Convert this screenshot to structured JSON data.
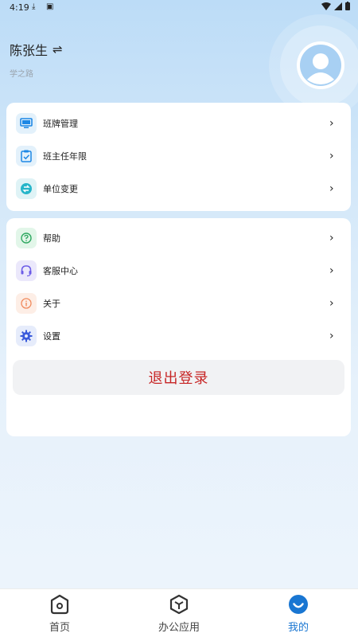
{
  "status_bar": {
    "time": "4:19"
  },
  "profile": {
    "name": "陈张生",
    "switch_icon": "⇌",
    "subtitle": "学之路"
  },
  "group1": [
    {
      "label": "班牌管理",
      "icon": "monitor-icon"
    },
    {
      "label": "班主任年限",
      "icon": "clipboard-check-icon"
    },
    {
      "label": "单位变更",
      "icon": "exchange-icon"
    }
  ],
  "group2": [
    {
      "label": "帮助",
      "icon": "help-circle-icon"
    },
    {
      "label": "客服中心",
      "icon": "headset-icon"
    },
    {
      "label": "关于",
      "icon": "info-icon"
    },
    {
      "label": "设置",
      "icon": "gear-icon"
    }
  ],
  "logout_label": "退出登录",
  "chevron": "›",
  "nav": [
    {
      "label": "首页",
      "active": false
    },
    {
      "label": "办公应用",
      "active": false
    },
    {
      "label": "我的",
      "active": true
    }
  ],
  "colors": {
    "accent": "#1976d2",
    "logout_text": "#c72525"
  }
}
